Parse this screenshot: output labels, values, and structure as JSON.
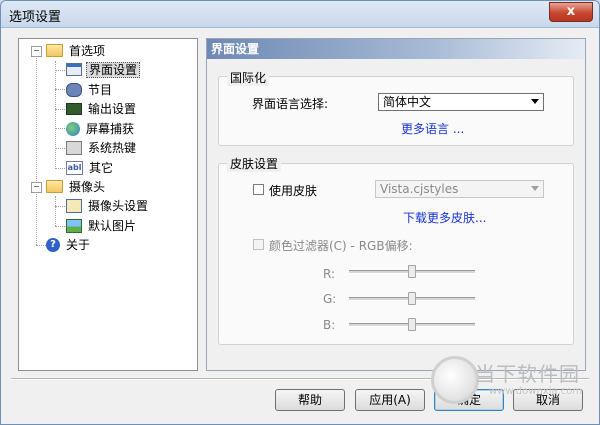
{
  "window": {
    "title": "选项设置",
    "close_glyph": "x"
  },
  "tree": {
    "items": [
      {
        "label": "首选项",
        "icon": "folder-icon"
      },
      {
        "label": "界面设置",
        "icon": "window-icon"
      },
      {
        "label": "节目",
        "icon": "film-icon"
      },
      {
        "label": "输出设置",
        "icon": "output-icon"
      },
      {
        "label": "屏幕捕获",
        "icon": "globe-icon"
      },
      {
        "label": "系统热键",
        "icon": "keyboard-icon"
      },
      {
        "label": "其它",
        "icon": "abl-icon",
        "icon_text": "abl"
      },
      {
        "label": "摄像头",
        "icon": "folder-icon"
      },
      {
        "label": "摄像头设置",
        "icon": "camera-icon"
      },
      {
        "label": "默认图片",
        "icon": "picture-icon"
      },
      {
        "label": "关于",
        "icon": "help-icon",
        "icon_text": "?"
      }
    ],
    "expanders": {
      "preferences": "−",
      "camera": "−"
    }
  },
  "panel": {
    "header": "界面设置",
    "intl": {
      "title": "国际化",
      "lang_label": "界面语言选择:",
      "lang_value": "简体中文",
      "more_lang": "更多语言 ..."
    },
    "skin": {
      "title": "皮肤设置",
      "use_skin_label": "使用皮肤",
      "use_skin_checked": false,
      "skin_value": "Vista.cjstyles",
      "download_more": "下载更多皮肤...",
      "color_filter_label": "颜色过滤器(C) - RGB偏移:",
      "color_filter_checked": false,
      "sliders": [
        {
          "label": "R:",
          "value": 0.5
        },
        {
          "label": "G:",
          "value": 0.5
        },
        {
          "label": "B:",
          "value": 0.5
        }
      ]
    }
  },
  "buttons": {
    "help": "帮助",
    "apply": "应用(A)",
    "ok": "确定",
    "cancel": "取消"
  },
  "watermark": {
    "text": "当下软件园",
    "url": "www.downxia.com"
  }
}
